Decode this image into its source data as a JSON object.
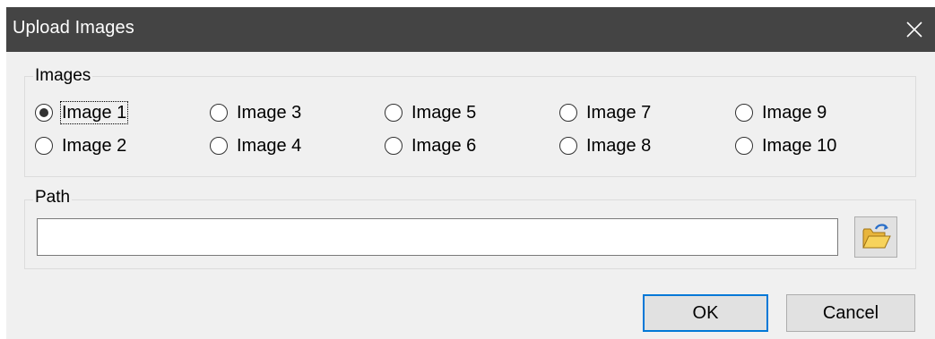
{
  "window": {
    "title": "Upload Images"
  },
  "images_group": {
    "label": "Images",
    "options": [
      {
        "label": "Image 1",
        "checked": true
      },
      {
        "label": "Image 2",
        "checked": false
      },
      {
        "label": "Image 3",
        "checked": false
      },
      {
        "label": "Image 4",
        "checked": false
      },
      {
        "label": "Image 5",
        "checked": false
      },
      {
        "label": "Image 6",
        "checked": false
      },
      {
        "label": "Image 7",
        "checked": false
      },
      {
        "label": "Image 8",
        "checked": false
      },
      {
        "label": "Image 9",
        "checked": false
      },
      {
        "label": "Image 10",
        "checked": false
      }
    ]
  },
  "path_group": {
    "label": "Path",
    "value": "",
    "browse_icon": "open-folder-icon"
  },
  "buttons": {
    "ok": "OK",
    "cancel": "Cancel"
  },
  "colors": {
    "titlebar": "#444444",
    "dialog_bg": "#f0f0f0",
    "focus_accent": "#0078d7"
  }
}
